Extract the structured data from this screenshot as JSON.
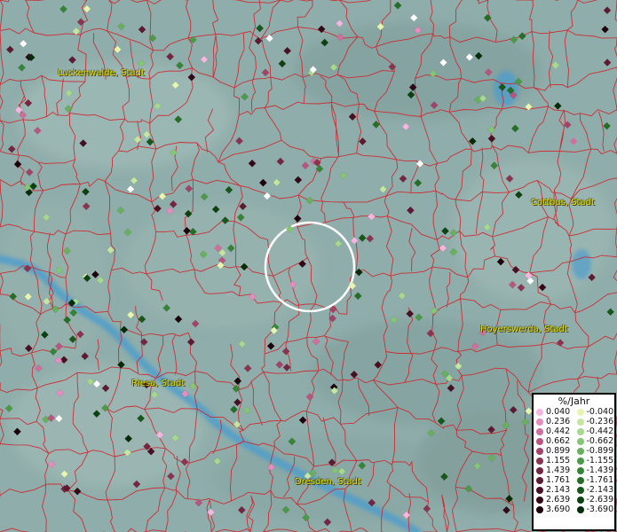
{
  "map": {
    "cities": [
      {
        "name": "Luckenwalde, Stadt"
      },
      {
        "name": "Cottbus, Stadt"
      },
      {
        "name": "Hoyerswerda, Stadt"
      },
      {
        "name": "Riesa, Stadt"
      },
      {
        "name": "Dresden, Stadt"
      }
    ]
  },
  "legend": {
    "title": "%/Jahr",
    "rows": [
      {
        "pos": "0.040",
        "neg": "-0.040",
        "pos_color": "#f7b6e0",
        "neg_color": "#e6f5b0"
      },
      {
        "pos": "0.236",
        "neg": "-0.236",
        "pos_color": "#e58cc0",
        "neg_color": "#c5e6a0"
      },
      {
        "pos": "0.442",
        "neg": "-0.442",
        "pos_color": "#d06e9c",
        "neg_color": "#a6d88e"
      },
      {
        "pos": "0.662",
        "neg": "-0.662",
        "pos_color": "#b85680",
        "neg_color": "#86c575"
      },
      {
        "pos": "0.899",
        "neg": "-0.899",
        "pos_color": "#a04468",
        "neg_color": "#68b05e"
      },
      {
        "pos": "1.155",
        "neg": "-1.155",
        "pos_color": "#8a3450",
        "neg_color": "#4c9a48"
      },
      {
        "pos": "1.439",
        "neg": "-1.439",
        "pos_color": "#742640",
        "neg_color": "#368436"
      },
      {
        "pos": "1.761",
        "neg": "-1.761",
        "pos_color": "#5e1a30",
        "neg_color": "#246e26"
      },
      {
        "pos": "2.143",
        "neg": "-2.143",
        "pos_color": "#481022",
        "neg_color": "#17581a"
      },
      {
        "pos": "2.639",
        "neg": "-2.639",
        "pos_color": "#320817",
        "neg_color": "#0c4210"
      },
      {
        "pos": "3.690",
        "neg": "-3.690",
        "pos_color": "#1e020a",
        "neg_color": "#052c08"
      }
    ]
  },
  "colors": {
    "background": "#8fadaa",
    "river": "#4f9ecb",
    "boundary": "#d0222a",
    "label": "#e7e000"
  }
}
